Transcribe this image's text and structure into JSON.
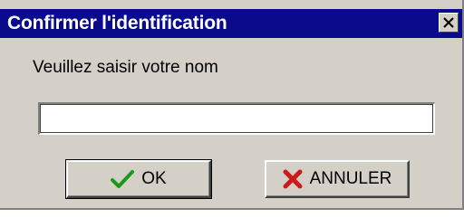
{
  "dialog": {
    "title": "Confirmer l'identification",
    "close_icon": "close-icon",
    "prompt": "Veuillez saisir votre nom",
    "name_input": {
      "value": "",
      "placeholder": ""
    },
    "ok_button": {
      "label": "OK",
      "icon": "check-icon",
      "icon_color": "#1a9a1a"
    },
    "cancel_button": {
      "label": "ANNULER",
      "icon": "cross-icon",
      "icon_color": "#cc1a1a"
    }
  },
  "colors": {
    "titlebar": "#0a0a8c",
    "face": "#d4d0c8"
  }
}
